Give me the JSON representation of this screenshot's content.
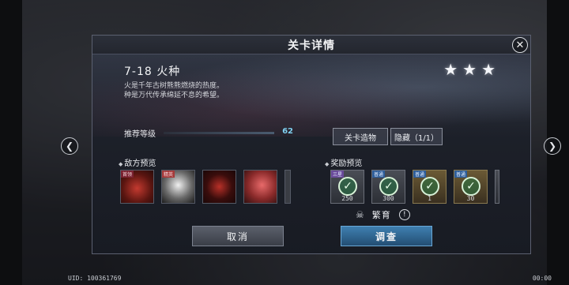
{
  "footer": {
    "uid": "UID: 100361769",
    "clock": "00:00"
  },
  "nav": {
    "prev_icon": "chevron-left-icon",
    "next_icon": "chevron-right-icon"
  },
  "dialog": {
    "title": "关卡详情",
    "close_icon": "close-icon",
    "stage_title": "7-18 火种",
    "description": [
      "火是千年古树熊熊燃烧的热度。",
      "种是万代传承绵延不息的希望。"
    ],
    "stars": {
      "earned": 3,
      "total": 3
    },
    "recommended_label": "推荐等级",
    "recommended_level": "62",
    "tabs": [
      "关卡造物",
      "隐藏（1/1）"
    ],
    "enemy_section": "敌方预览",
    "reward_section": "奖励预览",
    "enemies": [
      {
        "tag": "首领",
        "style": "red"
      },
      {
        "tag": "精英",
        "style": "bw"
      },
      {
        "tag": "",
        "style": "dark"
      },
      {
        "tag": "",
        "style": "pink"
      }
    ],
    "rewards": [
      {
        "tag": "三星",
        "count": "250",
        "claimed": true
      },
      {
        "tag": "普通",
        "count": "300",
        "claimed": true
      },
      {
        "tag": "普通",
        "count": "1",
        "claimed": true
      },
      {
        "tag": "普通",
        "count": "30",
        "claimed": true
      }
    ],
    "fertile_label": "繁育",
    "buttons": {
      "cancel": "取消",
      "investigate": "调查"
    }
  }
}
